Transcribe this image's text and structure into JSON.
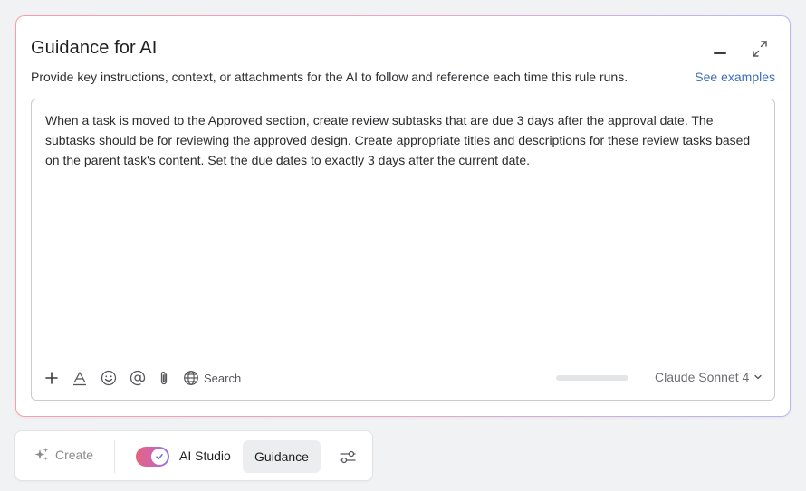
{
  "panel": {
    "title": "Guidance for AI",
    "subtitle": "Provide key instructions, context, or attachments for the AI to follow and reference each time this rule runs.",
    "see_examples": "See examples",
    "border_gradient": [
      "#f3a0a8",
      "#b9b7f2"
    ]
  },
  "editor": {
    "text": "When a task is moved to the Approved section, create review subtasks that are due 3 days after the approval date. The subtasks should be for reviewing the approved design. Create appropriate titles and descriptions for these review tasks based on the parent task's content. Set the due dates to exactly 3 days after the current date."
  },
  "toolbar": {
    "icons": [
      "plus-icon",
      "text-format-icon",
      "emoji-icon",
      "mention-icon",
      "attachment-icon",
      "globe-icon"
    ],
    "search_label": "Search",
    "progress_fraction": 0.0,
    "model_label": "Claude Sonnet 4"
  },
  "bottom_bar": {
    "create_label": "Create",
    "ai_studio_label": "AI Studio",
    "ai_studio_enabled": true,
    "guidance_label": "Guidance"
  },
  "colors": {
    "link": "#3d6fb6",
    "toggle_gradient": [
      "#e8637b",
      "#8b79e8"
    ]
  }
}
